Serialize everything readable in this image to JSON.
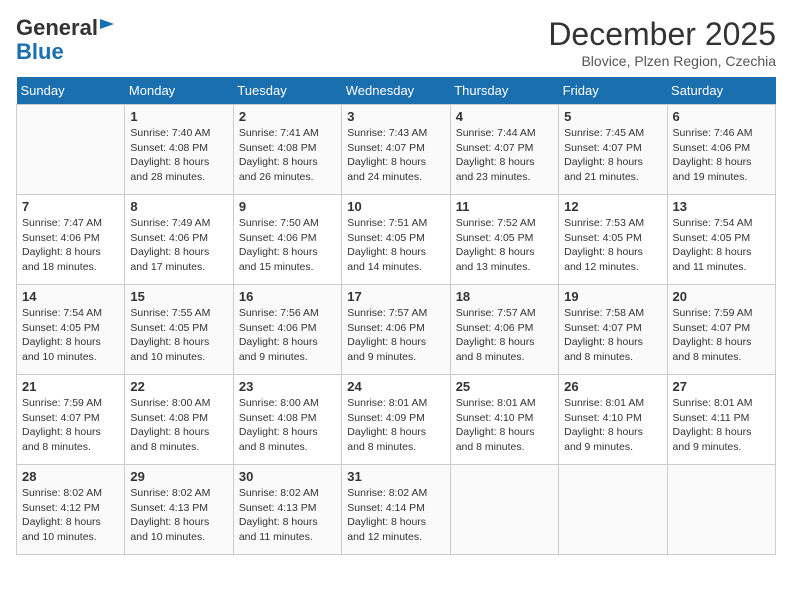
{
  "header": {
    "logo_line1": "General",
    "logo_line2": "Blue",
    "month": "December 2025",
    "location": "Blovice, Plzen Region, Czechia"
  },
  "weekdays": [
    "Sunday",
    "Monday",
    "Tuesday",
    "Wednesday",
    "Thursday",
    "Friday",
    "Saturday"
  ],
  "weeks": [
    [
      {
        "day": "",
        "info": ""
      },
      {
        "day": "1",
        "info": "Sunrise: 7:40 AM\nSunset: 4:08 PM\nDaylight: 8 hours\nand 28 minutes."
      },
      {
        "day": "2",
        "info": "Sunrise: 7:41 AM\nSunset: 4:08 PM\nDaylight: 8 hours\nand 26 minutes."
      },
      {
        "day": "3",
        "info": "Sunrise: 7:43 AM\nSunset: 4:07 PM\nDaylight: 8 hours\nand 24 minutes."
      },
      {
        "day": "4",
        "info": "Sunrise: 7:44 AM\nSunset: 4:07 PM\nDaylight: 8 hours\nand 23 minutes."
      },
      {
        "day": "5",
        "info": "Sunrise: 7:45 AM\nSunset: 4:07 PM\nDaylight: 8 hours\nand 21 minutes."
      },
      {
        "day": "6",
        "info": "Sunrise: 7:46 AM\nSunset: 4:06 PM\nDaylight: 8 hours\nand 19 minutes."
      }
    ],
    [
      {
        "day": "7",
        "info": "Sunrise: 7:47 AM\nSunset: 4:06 PM\nDaylight: 8 hours\nand 18 minutes."
      },
      {
        "day": "8",
        "info": "Sunrise: 7:49 AM\nSunset: 4:06 PM\nDaylight: 8 hours\nand 17 minutes."
      },
      {
        "day": "9",
        "info": "Sunrise: 7:50 AM\nSunset: 4:06 PM\nDaylight: 8 hours\nand 15 minutes."
      },
      {
        "day": "10",
        "info": "Sunrise: 7:51 AM\nSunset: 4:05 PM\nDaylight: 8 hours\nand 14 minutes."
      },
      {
        "day": "11",
        "info": "Sunrise: 7:52 AM\nSunset: 4:05 PM\nDaylight: 8 hours\nand 13 minutes."
      },
      {
        "day": "12",
        "info": "Sunrise: 7:53 AM\nSunset: 4:05 PM\nDaylight: 8 hours\nand 12 minutes."
      },
      {
        "day": "13",
        "info": "Sunrise: 7:54 AM\nSunset: 4:05 PM\nDaylight: 8 hours\nand 11 minutes."
      }
    ],
    [
      {
        "day": "14",
        "info": "Sunrise: 7:54 AM\nSunset: 4:05 PM\nDaylight: 8 hours\nand 10 minutes."
      },
      {
        "day": "15",
        "info": "Sunrise: 7:55 AM\nSunset: 4:05 PM\nDaylight: 8 hours\nand 10 minutes."
      },
      {
        "day": "16",
        "info": "Sunrise: 7:56 AM\nSunset: 4:06 PM\nDaylight: 8 hours\nand 9 minutes."
      },
      {
        "day": "17",
        "info": "Sunrise: 7:57 AM\nSunset: 4:06 PM\nDaylight: 8 hours\nand 9 minutes."
      },
      {
        "day": "18",
        "info": "Sunrise: 7:57 AM\nSunset: 4:06 PM\nDaylight: 8 hours\nand 8 minutes."
      },
      {
        "day": "19",
        "info": "Sunrise: 7:58 AM\nSunset: 4:07 PM\nDaylight: 8 hours\nand 8 minutes."
      },
      {
        "day": "20",
        "info": "Sunrise: 7:59 AM\nSunset: 4:07 PM\nDaylight: 8 hours\nand 8 minutes."
      }
    ],
    [
      {
        "day": "21",
        "info": "Sunrise: 7:59 AM\nSunset: 4:07 PM\nDaylight: 8 hours\nand 8 minutes."
      },
      {
        "day": "22",
        "info": "Sunrise: 8:00 AM\nSunset: 4:08 PM\nDaylight: 8 hours\nand 8 minutes."
      },
      {
        "day": "23",
        "info": "Sunrise: 8:00 AM\nSunset: 4:08 PM\nDaylight: 8 hours\nand 8 minutes."
      },
      {
        "day": "24",
        "info": "Sunrise: 8:01 AM\nSunset: 4:09 PM\nDaylight: 8 hours\nand 8 minutes."
      },
      {
        "day": "25",
        "info": "Sunrise: 8:01 AM\nSunset: 4:10 PM\nDaylight: 8 hours\nand 8 minutes."
      },
      {
        "day": "26",
        "info": "Sunrise: 8:01 AM\nSunset: 4:10 PM\nDaylight: 8 hours\nand 9 minutes."
      },
      {
        "day": "27",
        "info": "Sunrise: 8:01 AM\nSunset: 4:11 PM\nDaylight: 8 hours\nand 9 minutes."
      }
    ],
    [
      {
        "day": "28",
        "info": "Sunrise: 8:02 AM\nSunset: 4:12 PM\nDaylight: 8 hours\nand 10 minutes."
      },
      {
        "day": "29",
        "info": "Sunrise: 8:02 AM\nSunset: 4:13 PM\nDaylight: 8 hours\nand 10 minutes."
      },
      {
        "day": "30",
        "info": "Sunrise: 8:02 AM\nSunset: 4:13 PM\nDaylight: 8 hours\nand 11 minutes."
      },
      {
        "day": "31",
        "info": "Sunrise: 8:02 AM\nSunset: 4:14 PM\nDaylight: 8 hours\nand 12 minutes."
      },
      {
        "day": "",
        "info": ""
      },
      {
        "day": "",
        "info": ""
      },
      {
        "day": "",
        "info": ""
      }
    ]
  ]
}
